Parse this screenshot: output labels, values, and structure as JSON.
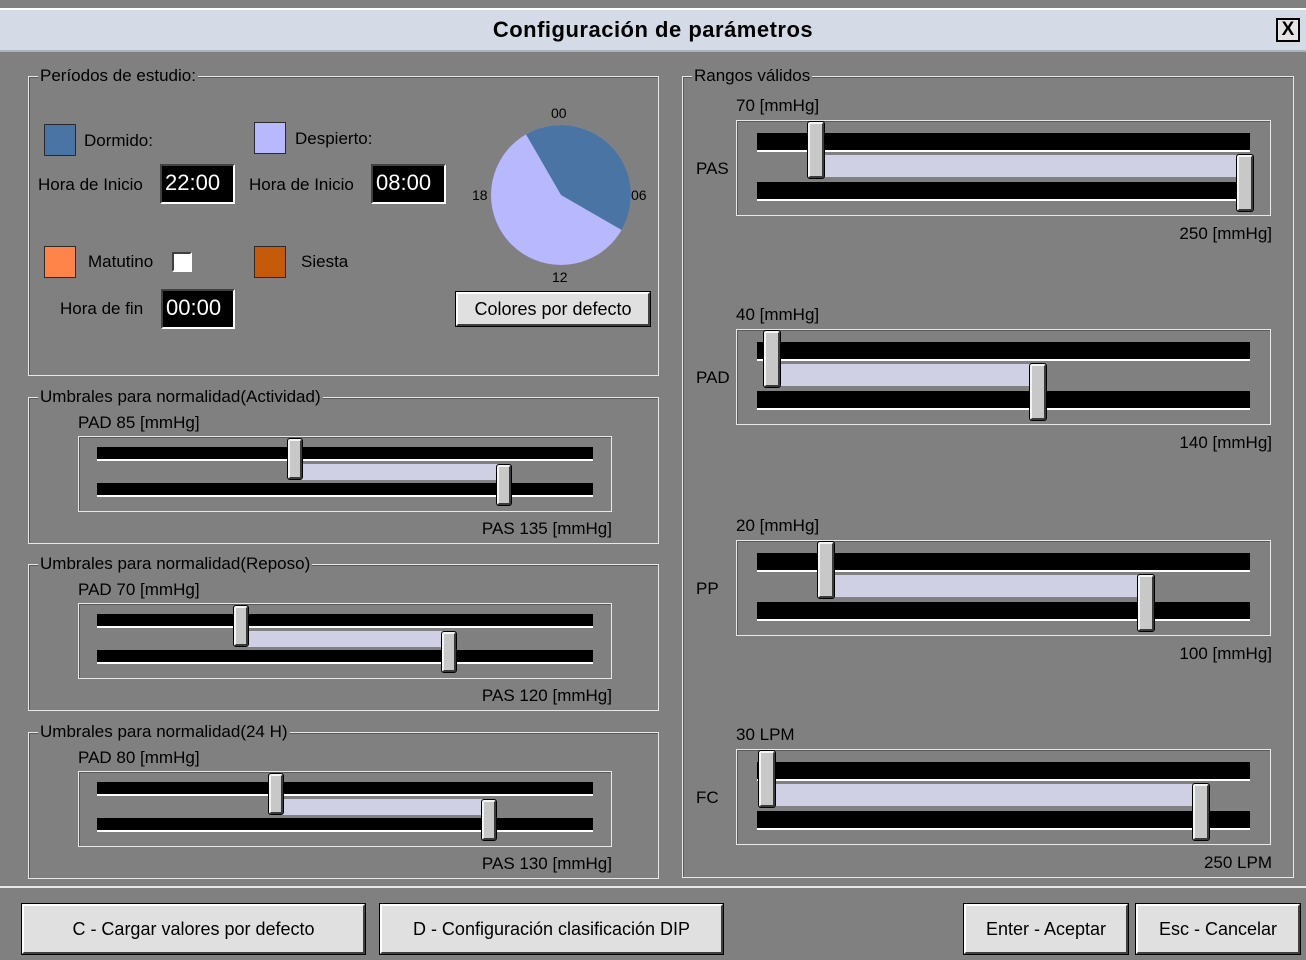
{
  "window": {
    "title": "Configuración de parámetros",
    "close_label": "X"
  },
  "periods": {
    "legend": "Períodos de estudio:",
    "dormido": {
      "label": "Dormido:",
      "color": "#4a74a4",
      "start_label": "Hora de Inicio",
      "start_value": "22:00"
    },
    "despierto": {
      "label": "Despierto:",
      "color": "#b8b8ff",
      "start_label": "Hora de Inicio",
      "start_value": "08:00"
    },
    "matutino": {
      "label": "Matutino",
      "color": "#ff844a",
      "checked": false,
      "end_label": "Hora de fin",
      "end_value": "00:00"
    },
    "siesta": {
      "label": "Siesta",
      "color": "#c45a0a"
    },
    "clock": {
      "labels": {
        "top": "00",
        "right": "06",
        "bottom": "12",
        "left": "18"
      },
      "sleep_color": "#4a74a4",
      "awake_color": "#b8b8ff"
    },
    "default_colors_button": "Colores por defecto"
  },
  "thresholds": [
    {
      "legend": "Umbrales para normalidad(Actividad)",
      "pad_label": "PAD 85 [mmHg]",
      "pas_label": "PAS 135 [mmHg]",
      "low_fraction": 0.4,
      "high_fraction": 0.82
    },
    {
      "legend": "Umbrales para normalidad(Reposo)",
      "pad_label": "PAD 70 [mmHg]",
      "pas_label": "PAS 120 [mmHg]",
      "low_fraction": 0.29,
      "high_fraction": 0.71
    },
    {
      "legend": "Umbrales para normalidad(24 H)",
      "pad_label": "PAD 80 [mmHg]",
      "pas_label": "PAS 130 [mmHg]",
      "low_fraction": 0.36,
      "high_fraction": 0.79
    }
  ],
  "ranges": {
    "legend": "Rangos válidos",
    "items": [
      {
        "name": "PAS",
        "min_label": "70 [mmHg]",
        "max_label": "250 [mmHg]",
        "low_fraction": 0.12,
        "high_fraction": 0.99
      },
      {
        "name": "PAD",
        "min_label": "40 [mmHg]",
        "max_label": "140 [mmHg]",
        "low_fraction": 0.03,
        "high_fraction": 0.57
      },
      {
        "name": "PP",
        "min_label": "20 [mmHg]",
        "max_label": "100 [mmHg]",
        "low_fraction": 0.14,
        "high_fraction": 0.79
      },
      {
        "name": "FC",
        "min_label": "30 LPM",
        "max_label": "250 LPM",
        "low_fraction": 0.02,
        "high_fraction": 0.9
      }
    ]
  },
  "footer": {
    "load_defaults": "C - Cargar valores por defecto",
    "dip_config": "D - Configuración clasificación DIP",
    "accept": "Enter - Aceptar",
    "cancel": "Esc - Cancelar"
  }
}
